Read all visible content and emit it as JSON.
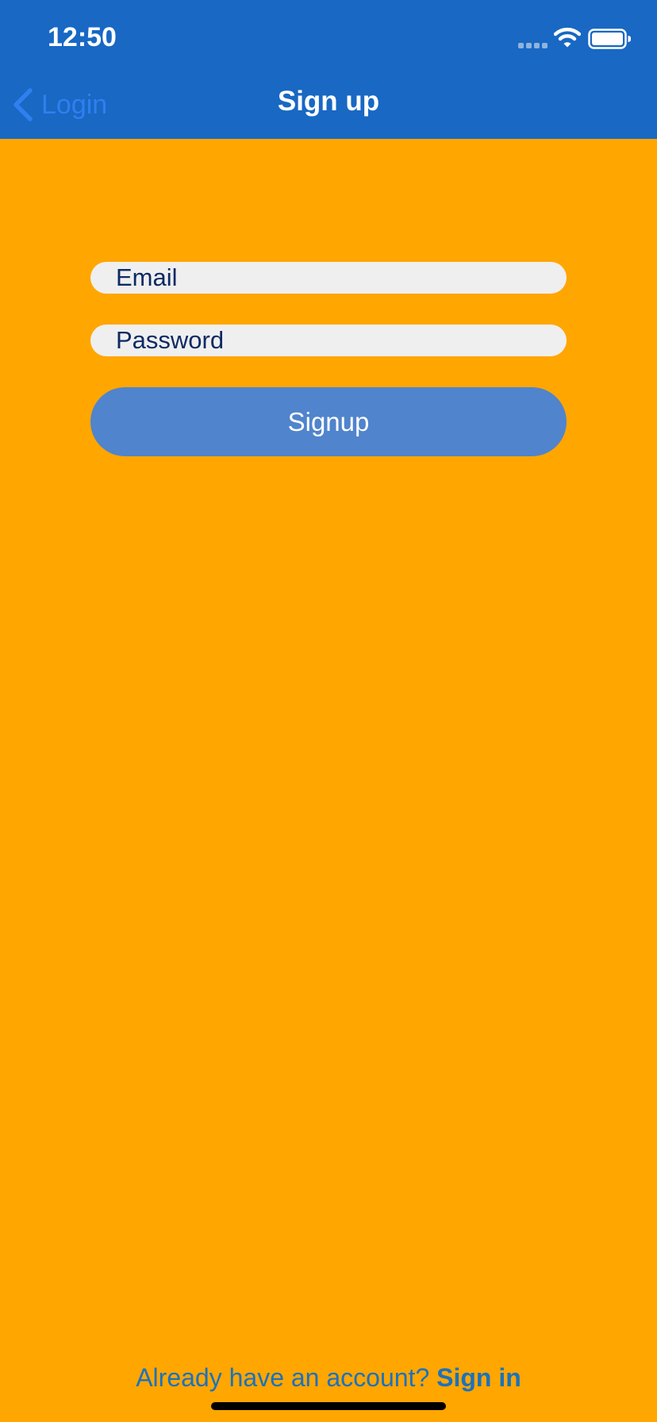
{
  "status_bar": {
    "time": "12:50",
    "signal_icon": "signal-icon",
    "wifi_icon": "wifi-icon",
    "battery_icon": "battery-icon"
  },
  "nav": {
    "back_label": "Login",
    "back_icon": "chevron-left-icon",
    "title": "Sign up"
  },
  "form": {
    "email_placeholder": "Email",
    "password_placeholder": "Password",
    "signup_label": "Signup"
  },
  "footer": {
    "prompt": "Already have an account? ",
    "link": "Sign in"
  },
  "colors": {
    "header": "#1868C4",
    "background": "#FFA600",
    "button": "#5084CC",
    "field": "#EFEFEF",
    "link": "#1B72BC",
    "back_link": "#2F7FF0"
  }
}
